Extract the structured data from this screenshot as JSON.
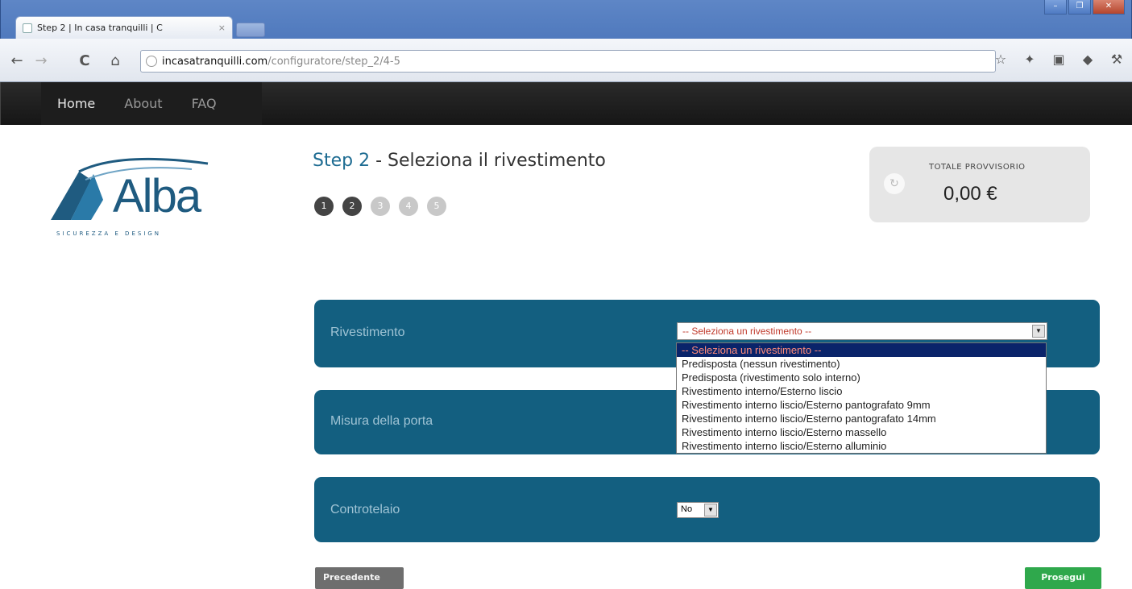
{
  "browser": {
    "tab_title": "Step 2 | In casa tranquilli | C",
    "tab_close": "×",
    "url_host": "incasatranquilli.com",
    "url_path": "/configuratore/step_2/4-5",
    "nav_back": "←",
    "nav_forward": "→",
    "nav_reload": "C",
    "nav_home": "⌂",
    "window_controls": [
      "–",
      "❐",
      "✕"
    ]
  },
  "site_nav": {
    "items": [
      {
        "label": "Home",
        "active": true
      },
      {
        "label": "About",
        "active": false
      },
      {
        "label": "FAQ",
        "active": false
      }
    ]
  },
  "logo": {
    "text": "Alba",
    "subtitle": "SICUREZZA E DESIGN"
  },
  "step": {
    "prefix": "Step 2",
    "separator": " - ",
    "title": "Seleziona il rivestimento",
    "dots": [
      {
        "label": "1",
        "state": "done"
      },
      {
        "label": "2",
        "state": "done"
      },
      {
        "label": "3",
        "state": "todo"
      },
      {
        "label": "4",
        "state": "todo"
      },
      {
        "label": "5",
        "state": "todo"
      }
    ]
  },
  "total": {
    "label": "TOTALE PROVVISORIO",
    "value": "0,00 €"
  },
  "form": {
    "rivestimento": {
      "label": "Rivestimento",
      "selected": "-- Seleziona un rivestimento --",
      "options": [
        "-- Seleziona un rivestimento --",
        "Predisposta (nessun rivestimento)",
        "Predisposta (rivestimento solo interno)",
        "Rivestimento interno/Esterno liscio",
        "Rivestimento interno liscio/Esterno pantografato 9mm",
        "Rivestimento interno liscio/Esterno pantografato 14mm",
        "Rivestimento interno liscio/Esterno massello",
        "Rivestimento interno liscio/Esterno alluminio"
      ]
    },
    "misura": {
      "label": "Misura della porta"
    },
    "controtelaio": {
      "label": "Controtelaio",
      "selected": "No"
    }
  },
  "buttons": {
    "prev": "Precedente",
    "next": "Prosegui"
  },
  "colors": {
    "panel": "#135f80",
    "next_button": "#2fa84c",
    "prev_button": "#6e6e6e"
  }
}
